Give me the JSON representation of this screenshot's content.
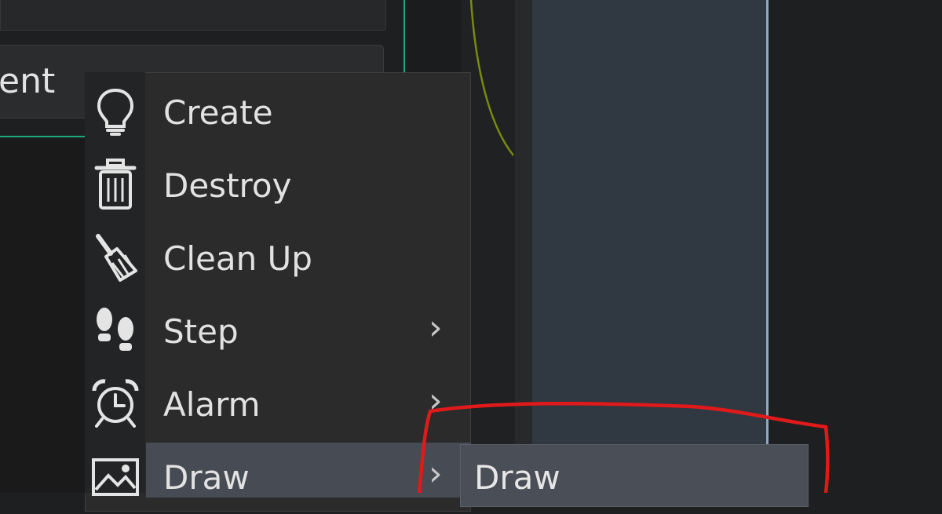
{
  "event_panel": {
    "label": "ent"
  },
  "context_menu": {
    "items": [
      {
        "label": "Create",
        "icon": "lightbulb-icon",
        "has_submenu": false
      },
      {
        "label": "Destroy",
        "icon": "trash-icon",
        "has_submenu": false
      },
      {
        "label": "Clean Up",
        "icon": "broom-icon",
        "has_submenu": false
      },
      {
        "label": "Step",
        "icon": "footsteps-icon",
        "has_submenu": true
      },
      {
        "label": "Alarm",
        "icon": "alarm-clock-icon",
        "has_submenu": true
      },
      {
        "label": "Draw",
        "icon": "image-icon",
        "has_submenu": true,
        "highlighted": true
      }
    ]
  },
  "submenu": {
    "items": [
      {
        "label": "Draw"
      }
    ]
  },
  "colors": {
    "accent_green": "#1fa77d",
    "highlight": "#474b53",
    "annotation_red": "#e01a1a",
    "panel_slate": "#303842"
  }
}
